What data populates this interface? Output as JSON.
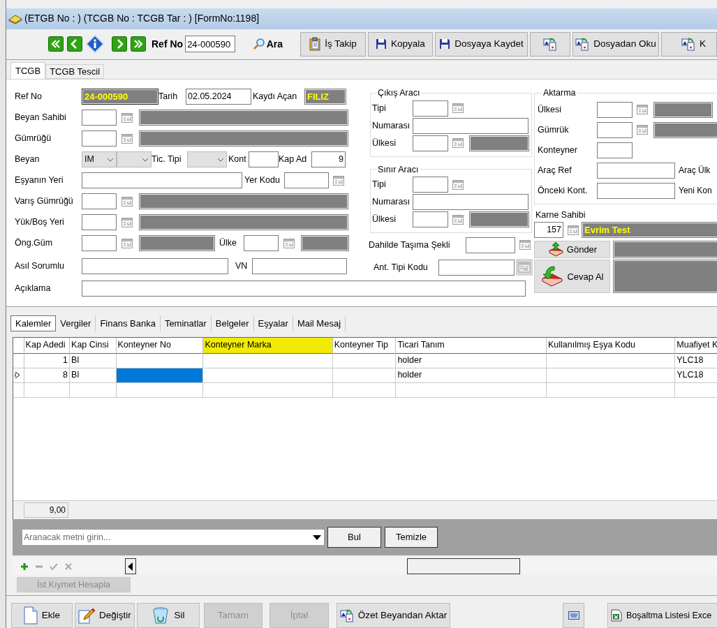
{
  "window": {
    "title": "(ETGB No : ) (TCGB No :  TCGB Tar : ) [FormNo:1198]"
  },
  "navigator": {
    "ref_label": "Ref No",
    "ref_value": "24-000590",
    "search_label": "Ara"
  },
  "toolbar": [
    {
      "kind": "labeled",
      "label": "İş Takip"
    },
    {
      "kind": "labeled",
      "label": "Kopyala"
    },
    {
      "kind": "labeled",
      "label": "Dosyaya Kaydet"
    },
    {
      "kind": "icon"
    },
    {
      "kind": "labeled",
      "label": "Dosyadan Oku"
    },
    {
      "kind": "labeled",
      "label": "K"
    }
  ],
  "tabs": [
    {
      "label": "TCGB",
      "selected": true
    },
    {
      "label": "TCGB Tescil",
      "selected": false
    }
  ],
  "form": {
    "ref_no": {
      "label": "Ref No",
      "value": "24-000590"
    },
    "tarih": {
      "label": "Tarih",
      "value": "02.05.2024"
    },
    "kaydi_acan": {
      "label": "Kaydı Açan",
      "value": "FILIZ"
    },
    "beyan_sahibi": {
      "label": "Beyan Sahibi"
    },
    "gumrugu": {
      "label": "Gümrüğü"
    },
    "beyan": {
      "label": "Beyan",
      "value": "IM"
    },
    "tic_tipi": {
      "label": "Tic. Tipi"
    },
    "kont": {
      "label": "Kont"
    },
    "kap_ad": {
      "label": "Kap Ad",
      "value": "9"
    },
    "esyanin_yeri": {
      "label": "Eşyanın Yeri"
    },
    "yer_kodu": {
      "label": "Yer Kodu"
    },
    "varis_gumrugu": {
      "label": "Varış Gümrüğü"
    },
    "yuk_bos_yeri": {
      "label": "Yük/Boş Yeri"
    },
    "ong_gum": {
      "label": "Öng.Güm"
    },
    "ulke": {
      "label": "Ülke"
    },
    "asil_sorumlu": {
      "label": "Asıl Sorumlu"
    },
    "vn": {
      "label": "VN"
    },
    "aciklama": {
      "label": "Açıklama"
    }
  },
  "cikis_araci": {
    "title": "Çıkış Aracı",
    "tipi": "Tipi",
    "numarasi": "Numarası",
    "ulkesi": "Ülkesi"
  },
  "sinir_araci": {
    "title": "Sınır Aracı",
    "tipi": "Tipi",
    "numarasi": "Numarası",
    "ulkesi": "Ülkesi"
  },
  "dahilde_tasima_sekli": {
    "label": "Dahilde Taşıma Şekli"
  },
  "ant_tipi_kodu": {
    "label": "Ant. Tipi Kodu"
  },
  "aktarma": {
    "title": "Aktarma",
    "ulkesi": "Ülkesi",
    "gumruk": "Gümrük",
    "konteyner": "Konteyner",
    "arac_ref": "Araç Ref",
    "arac_ulk": "Araç Ülk",
    "onceki_kont": "Önceki Kont.",
    "yeni_kon": "Yeni Kon"
  },
  "karne_sahibi": {
    "label": "Karne Sahibi",
    "code": "157",
    "name": "Evrim Test"
  },
  "send_buttons": [
    {
      "label": "Gönder"
    },
    {
      "label": "Cevap Al"
    }
  ],
  "detail_tabs": [
    {
      "label": "Kalemler",
      "selected": true
    },
    {
      "label": "Vergiler",
      "selected": false
    },
    {
      "label": "Finans Banka",
      "selected": false
    },
    {
      "label": "Teminatlar",
      "selected": false
    },
    {
      "label": "Belgeler",
      "selected": false
    },
    {
      "label": "Eşyalar",
      "selected": false
    },
    {
      "label": "Mail Mesaj",
      "selected": false
    }
  ],
  "grid": {
    "columns": [
      {
        "label": "Kap Adedi",
        "highlighted": false
      },
      {
        "label": "Kap Cinsi",
        "highlighted": false
      },
      {
        "label": "Konteyner No",
        "highlighted": false
      },
      {
        "label": "Konteyner Marka",
        "highlighted": true
      },
      {
        "label": "Konteyner Tip",
        "highlighted": false
      },
      {
        "label": "Ticari Tanım",
        "highlighted": false
      },
      {
        "label": "Kullanılmış Eşya Kodu",
        "highlighted": false
      },
      {
        "label": "Muafiyet K",
        "highlighted": false
      }
    ],
    "rows": [
      {
        "selected": false,
        "cells": [
          {
            "text": "1",
            "selected": false
          },
          {
            "text": "Bl",
            "selected": false
          },
          {
            "selected": false
          },
          {
            "selected": false
          },
          {
            "selected": false
          },
          {
            "text": "holder",
            "selected": false
          },
          {
            "selected": false
          },
          {
            "text": "YLC18",
            "selected": false
          }
        ]
      },
      {
        "selected": true,
        "cells": [
          {
            "text": "8",
            "selected": false
          },
          {
            "text": "Bl",
            "selected": false
          },
          {
            "selected": true
          },
          {
            "selected": false
          },
          {
            "selected": false
          },
          {
            "text": "holder",
            "selected": false
          },
          {
            "selected": false
          },
          {
            "text": "YLC18",
            "selected": false
          }
        ]
      }
    ],
    "total": "9,00"
  },
  "search": {
    "placeholder": "Aranacak metni girin...",
    "buttons": [
      "Bul",
      "Temizle"
    ]
  },
  "ist_kiymet_button": {
    "label": "İst Kıymet Hesapla",
    "disabled": true
  },
  "bottom_buttons": [
    {
      "label": "Ekle",
      "disabled": false
    },
    {
      "label": "Değiştir",
      "disabled": false
    },
    {
      "label": "Sil",
      "disabled": false
    },
    {
      "label": "Tamam",
      "disabled": true
    },
    {
      "label": "İptal",
      "disabled": true
    },
    {
      "label": "Özet Beyandan Aktar",
      "disabled": false
    },
    {
      "disabled": false
    },
    {
      "label": "Boşaltma Listesi Exce",
      "disabled": false
    }
  ]
}
